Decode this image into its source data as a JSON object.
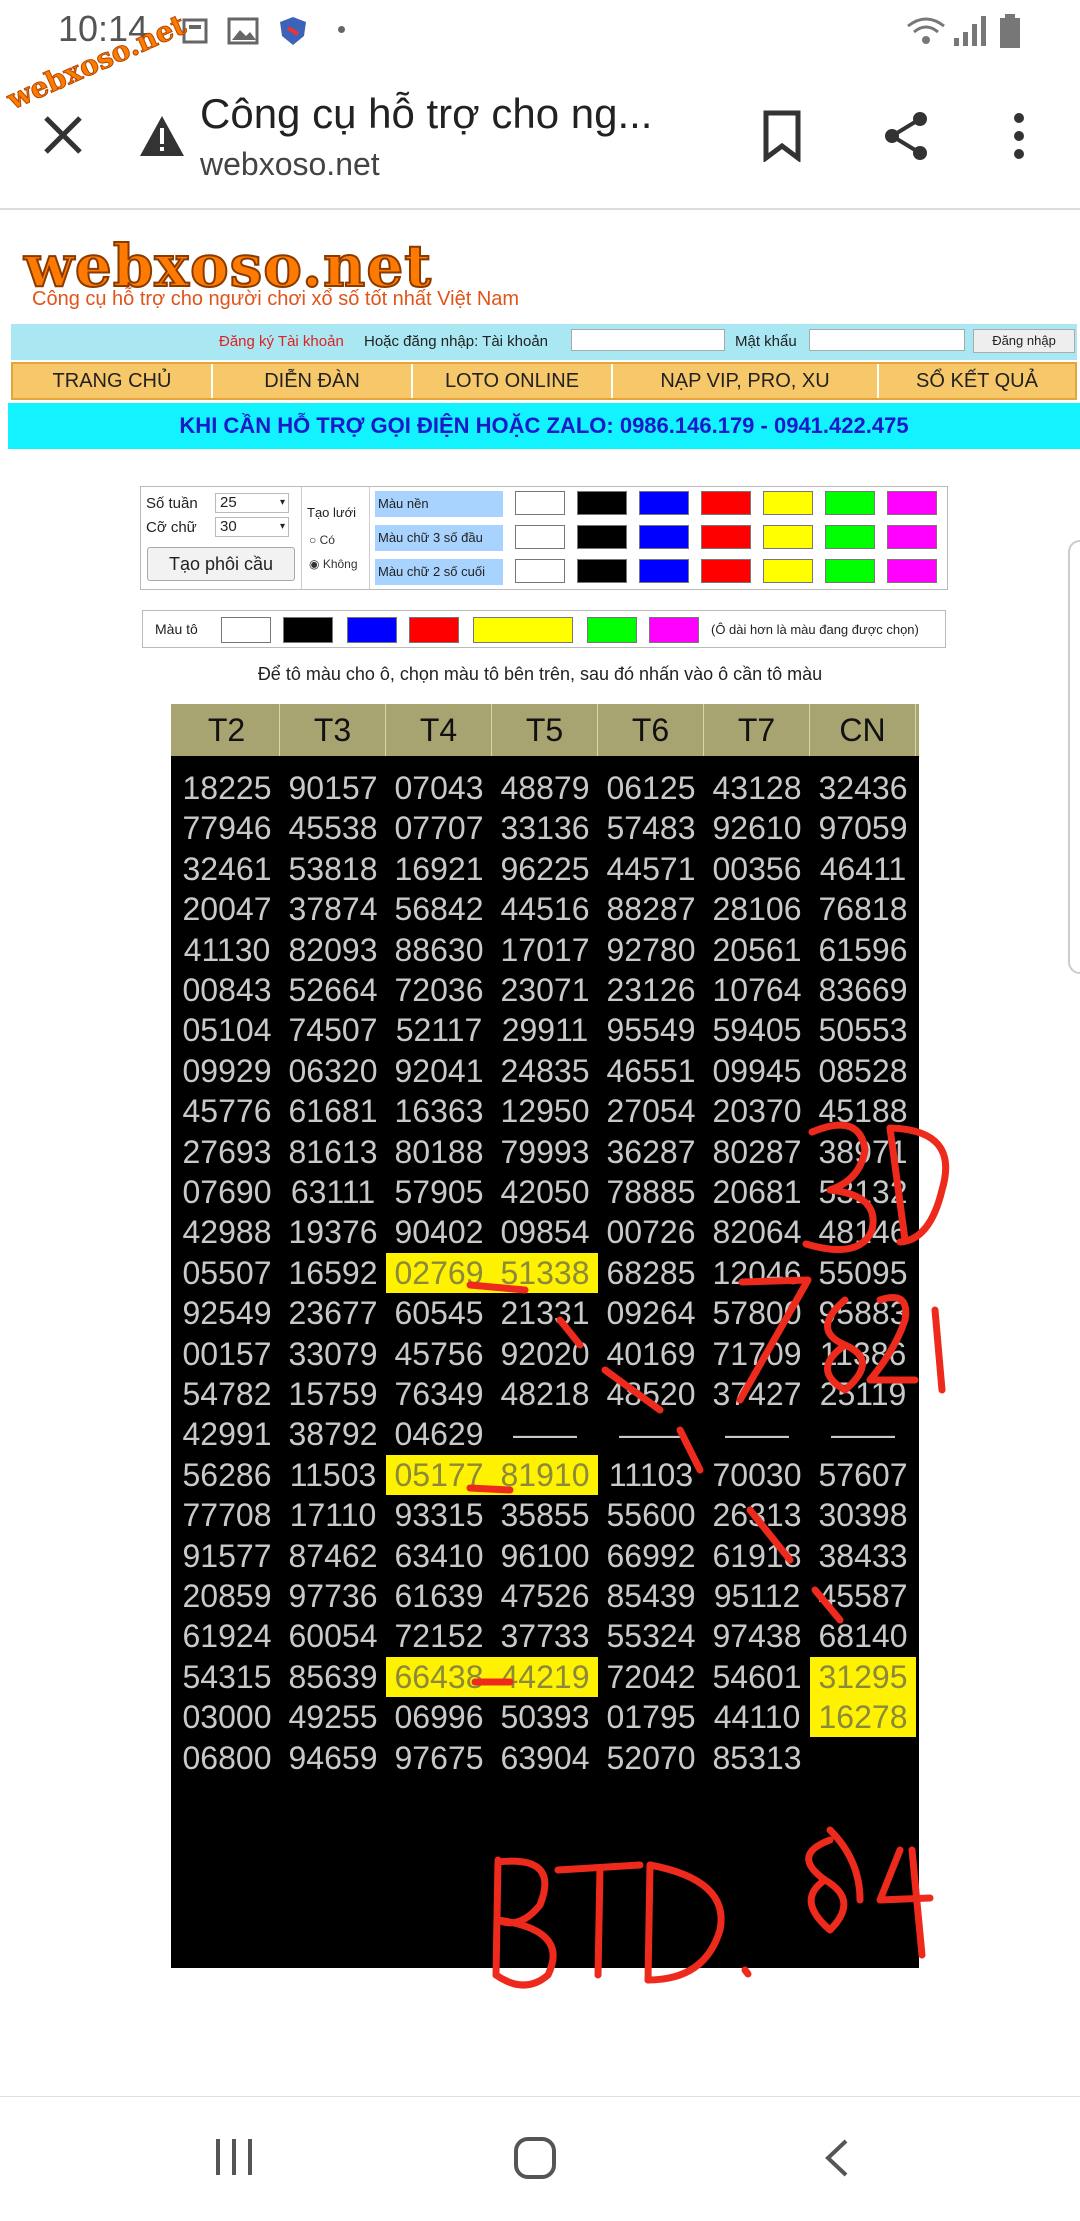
{
  "status": {
    "time": "10:14"
  },
  "browser": {
    "title": "Công cụ hỗ trợ cho ng...",
    "url": "webxoso.net"
  },
  "site": {
    "logo": "webxoso.net",
    "tagline": "Công cụ hỗ trợ cho người chơi xổ số tốt nhất Việt Nam",
    "watermark": "webxoso.net"
  },
  "login": {
    "register": "Đăng ký Tài khoản",
    "or_login": "Hoặc đăng nhập: Tài khoản",
    "password": "Mật khẩu",
    "button": "Đăng nhập"
  },
  "menu": [
    "TRANG CHỦ",
    "DIỄN ĐÀN",
    "LOTO ONLINE",
    "NẠP VIP, PRO, XU",
    "SỔ KẾT QUẢ"
  ],
  "hotline": "KHI CẦN HỖ TRỢ GỌI ĐIỆN HOẶC ZALO: 0986.146.179 - 0941.422.475",
  "controls": {
    "weeks_label": "Số tuần",
    "weeks_value": "25",
    "font_label": "Cỡ chữ",
    "font_value": "30",
    "create_button": "Tạo phôi cầu",
    "grid_label": "Tạo lưới",
    "grid_yes": "Có",
    "grid_no": "Không",
    "bg_color": "Màu nền",
    "color3": "Màu chữ 3 số đầu",
    "color2": "Màu chữ 2 số cuối",
    "paint_label": "Màu tô",
    "paint_note": "(Ô dài hơn là màu đang được chọn)",
    "instruction": "Để tô màu cho ô, chọn màu tô bên trên, sau đó nhấn vào ô cần tô màu"
  },
  "palette": [
    "#ffffff",
    "#000000",
    "#0000ff",
    "#ff0000",
    "#ffff00",
    "#00ff00",
    "#ff00ff"
  ],
  "table": {
    "headers": [
      "T2",
      "T3",
      "T4",
      "T5",
      "T6",
      "T7",
      "CN"
    ],
    "rows": [
      [
        "18225",
        "90157",
        "07043",
        "48879",
        "06125",
        "43128",
        "32436"
      ],
      [
        "77946",
        "45538",
        "07707",
        "33136",
        "57483",
        "92610",
        "97059"
      ],
      [
        "32461",
        "53818",
        "16921",
        "96225",
        "44571",
        "00356",
        "46411"
      ],
      [
        "20047",
        "37874",
        "56842",
        "44516",
        "88287",
        "28106",
        "76818"
      ],
      [
        "41130",
        "82093",
        "88630",
        "17017",
        "92780",
        "20561",
        "61596"
      ],
      [
        "00843",
        "52664",
        "72036",
        "23071",
        "23126",
        "10764",
        "83669"
      ],
      [
        "05104",
        "74507",
        "52117",
        "29911",
        "95549",
        "59405",
        "50553"
      ],
      [
        "09929",
        "06320",
        "92041",
        "24835",
        "46551",
        "09945",
        "08528"
      ],
      [
        "45776",
        "61681",
        "16363",
        "12950",
        "27054",
        "20370",
        "45188"
      ],
      [
        "27693",
        "81613",
        "80188",
        "79993",
        "36287",
        "80287",
        "38971"
      ],
      [
        "07690",
        "63111",
        "57905",
        "42050",
        "78885",
        "20681",
        "53132"
      ],
      [
        "42988",
        "19376",
        "90402",
        "09854",
        "00726",
        "82064",
        "48146"
      ],
      [
        "05507",
        "16592",
        "02769",
        "51338",
        "68285",
        "12046",
        "55095"
      ],
      [
        "92549",
        "23677",
        "60545",
        "21331",
        "09264",
        "57800",
        "95883"
      ],
      [
        "00157",
        "33079",
        "45756",
        "92020",
        "40169",
        "71709",
        "11386"
      ],
      [
        "54782",
        "15759",
        "76349",
        "48218",
        "48520",
        "37427",
        "25119"
      ],
      [
        "42991",
        "38792",
        "04629",
        "——",
        "——",
        "——",
        "——"
      ],
      [
        "56286",
        "11503",
        "05177",
        "81910",
        "11103",
        "70030",
        "57607"
      ],
      [
        "77708",
        "17110",
        "93315",
        "35855",
        "55600",
        "26313",
        "30398"
      ],
      [
        "91577",
        "87462",
        "63410",
        "96100",
        "66992",
        "61918",
        "38433"
      ],
      [
        "20859",
        "97736",
        "61639",
        "47526",
        "85439",
        "95112",
        "45587"
      ],
      [
        "61924",
        "60054",
        "72152",
        "37733",
        "55324",
        "97438",
        "68140"
      ],
      [
        "54315",
        "85639",
        "66438",
        "44219",
        "72042",
        "54601",
        "31295"
      ],
      [
        "03000",
        "49255",
        "06996",
        "50393",
        "01795",
        "44110",
        "16278"
      ],
      [
        "06800",
        "94659",
        "97675",
        "63904",
        "52070",
        "85313",
        ""
      ]
    ],
    "highlighted": [
      [
        12,
        2
      ],
      [
        12,
        3
      ],
      [
        17,
        2
      ],
      [
        17,
        3
      ],
      [
        22,
        2
      ],
      [
        22,
        3
      ],
      [
        22,
        6
      ],
      [
        23,
        6
      ]
    ]
  },
  "annotations": [
    "3D",
    "7821",
    "BTD. 84"
  ],
  "colors": {
    "highlight": "#fff200",
    "hotline_bg": "#12f2ff",
    "menu_bg": "#f7c86a",
    "red_ink": "#ee2a1c"
  }
}
